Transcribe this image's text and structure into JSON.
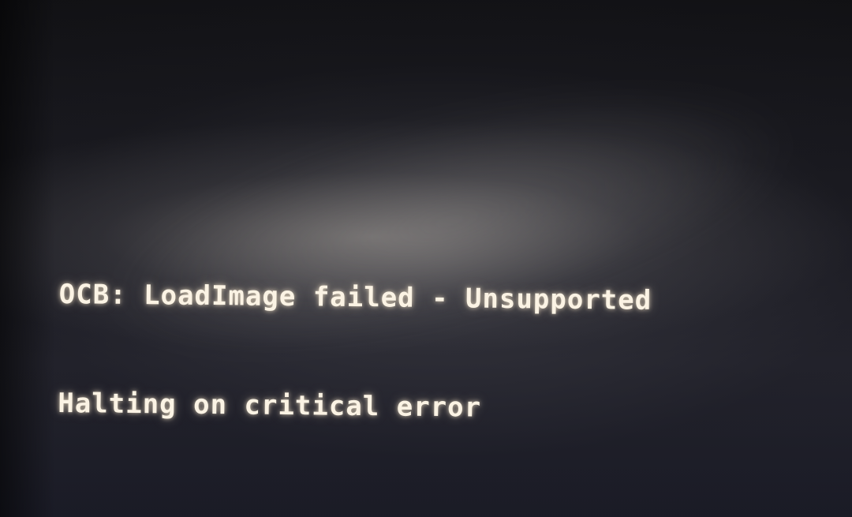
{
  "console": {
    "lines": [
      "OCB: LoadImage failed - Unsupported",
      "Halting on critical error"
    ]
  },
  "colors": {
    "text": "#fbf3e4",
    "background": "#0b0b10"
  }
}
